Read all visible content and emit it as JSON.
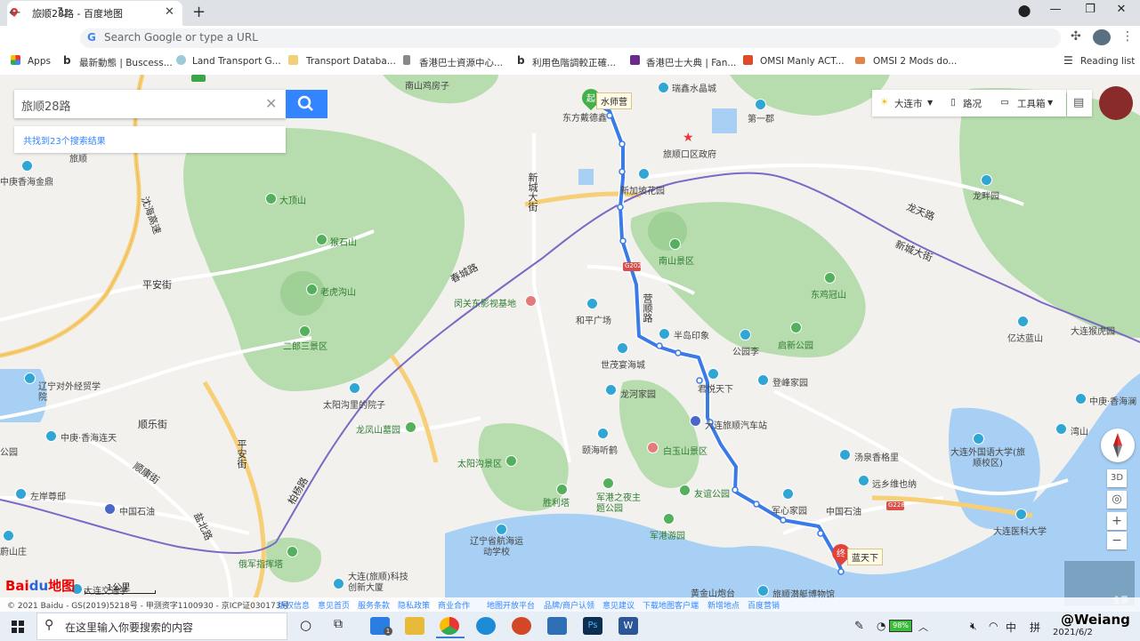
{
  "browser": {
    "tab_title": "旅顺28路 - 百度地图",
    "url_placeholder": "Search Google or type a URL",
    "bookmarks": [
      "Apps",
      "最新動態 | Buscess...",
      "Land Transport G...",
      "Transport Databa...",
      "香港巴士資源中心...",
      "利用色階調較正確...",
      "香港巴士大典 | Fan...",
      "OMSI Manly ACT...",
      "OMSI 2 Mods do..."
    ],
    "reading_list": "Reading list"
  },
  "search": {
    "query": "旅顺28路",
    "result_text": "共找到23个搜索结果"
  },
  "map_tools": {
    "city": "大连市",
    "traffic": "路况",
    "toolbox": "工具箱"
  },
  "controls": {
    "threed": "3D",
    "zoom_in": "+",
    "zoom_out": "−",
    "pano_label": "全景"
  },
  "route": {
    "start_badge": "起",
    "start_name": "水师营",
    "end_badge": "终",
    "end_name": "蓝天下"
  },
  "map_labels": {
    "nanshan_jiyuan": "南山鸡房子",
    "ruixin": "瑞鑫水晶城",
    "dongfang": "东方戴德鑫",
    "diyijun": "第一郡",
    "gov": "旅顺口区政府",
    "xinjiapo": "新加坡花园",
    "lvshun": "旅顺",
    "zhongjiao1": "中庚香海金鼎",
    "dadingshan": "大顶山",
    "houshishan": "猴石山",
    "laohugou": "老虎沟山",
    "erlangsan": "二郎三景区",
    "pinganjie": "平安街",
    "chunchenglu": "春城路",
    "shenyangjie": "沈海高速",
    "xinchengdajie": "新城大街",
    "xinchengdajie2": "新城大街",
    "longtianlu": "龙天路",
    "longpan": "龙畔园",
    "nanshan": "南山景区",
    "dongjiguan": "东鸡冠山",
    "yidalanshan": "亿达蓝山",
    "dalianhuyuan": "大连猴虎园",
    "guandong": "闵关东影视基地",
    "heping": "和平广场",
    "yingshunlu": "营顺路",
    "bandao": "半岛印象",
    "gongyuanli": "公园李",
    "qixin": "启新公园",
    "shijie": "世茂宴海城",
    "junyue": "君悦天下",
    "dengfeng": "登峰家园",
    "liaoning_jingmao": "辽宁对外经贸学院",
    "taiyanggou_yuan": "太阳沟里的院子",
    "longfeng": "龙凤山墓园",
    "longhe": "龙河家园",
    "qichezhan": "大连旅顺汽车站",
    "zhongjiao2": "中庚·香海连天",
    "shunlejie": "顺乐街",
    "yihai": "颐海听鹤",
    "baiyushan": "白玉山景区",
    "tangyuxiang": "汤泉香格里",
    "zhongjiao3": "中庚·香海澜",
    "wanshan": "湾山",
    "waiguoyu": "大连外国语大学(旅顺校区)",
    "taiyanggou": "太阳沟景区",
    "shunkangjie": "顺康街",
    "pingganjie": "平安街",
    "bailiangulu": "柏杨路",
    "shenglita": "胜利塔",
    "junganzhiye": "军港之夜主题公园",
    "youyi": "友谊公园",
    "junxin": "军心家园",
    "zhongguoshiyou": "中国石油",
    "zhongguoshiyou2": "中国石油",
    "yuanxiang": "远乡维也纳",
    "yikedaxue": "大连医科大学",
    "zuoan": "左岸尊邸",
    "yanbeilu": "盐北路",
    "hangyun": "辽宁省航海运动学校",
    "jungang": "军港游园",
    "eluo": "俄军指挥塔",
    "kejichuangxin": "大连(旅顺)科技创新大厦",
    "huangjinshan": "黄金山炮台",
    "qiantingbowuguan": "旅顺潜艇博物馆",
    "lanshan": "蔚山庄",
    "gongyuan_left": "公园",
    "dalianjiyuan": "大连交通学",
    "g202": "G202",
    "g228": "G228"
  },
  "footer": {
    "copyright": "© 2021 Baidu - GS(2019)5218号 - 甲测资字1100930 - 京ICP证030173号",
    "links": [
      "版权信息",
      "意见首页",
      "服务条款",
      "隐私政策",
      "商业合作",
      "地图开放平台",
      "品牌/商户认领",
      "意见建议",
      "下载地图客户端",
      "新增地点",
      "百度营销"
    ],
    "scale": "1公里",
    "logo": "Bai du 地图"
  },
  "taskbar": {
    "search_placeholder": "在这里输入你要搜索的内容",
    "badge": "1",
    "battery": "98%",
    "ime": "中",
    "ime2": "拼",
    "date": "2021/6/2",
    "watermark": "@Weiang"
  },
  "colors": {
    "route": "#3b7be8",
    "green_area": "#aed9a6",
    "water": "#a3cdf5",
    "baidu_blue": "#3385ff"
  }
}
